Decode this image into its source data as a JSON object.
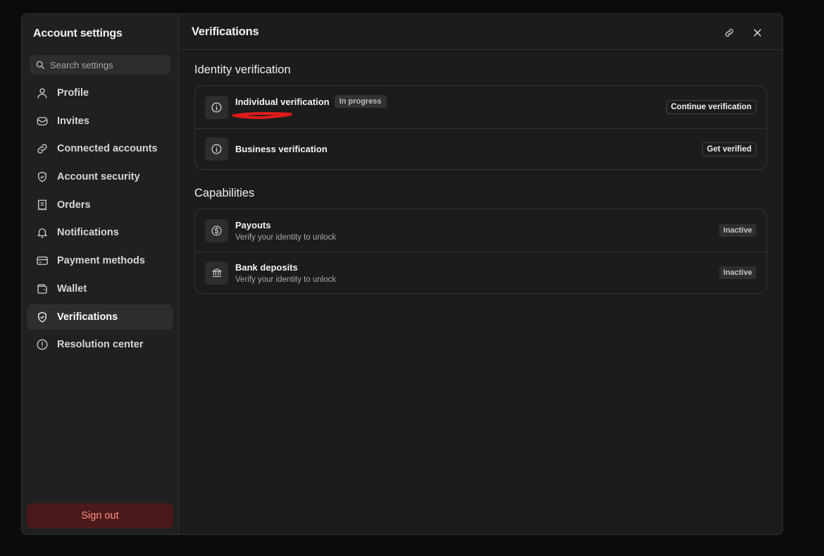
{
  "sidebar": {
    "title": "Account settings",
    "search_placeholder": "Search settings",
    "items": [
      {
        "label": "Profile",
        "icon": "user-icon"
      },
      {
        "label": "Invites",
        "icon": "inbox-icon"
      },
      {
        "label": "Connected accounts",
        "icon": "link-icon"
      },
      {
        "label": "Account security",
        "icon": "shield-icon"
      },
      {
        "label": "Orders",
        "icon": "receipt-icon"
      },
      {
        "label": "Notifications",
        "icon": "bell-icon"
      },
      {
        "label": "Payment methods",
        "icon": "credit-card-icon"
      },
      {
        "label": "Wallet",
        "icon": "wallet-icon"
      },
      {
        "label": "Verifications",
        "icon": "shield-check-icon",
        "active": true
      },
      {
        "label": "Resolution center",
        "icon": "alert-circle-icon"
      }
    ],
    "sign_out_label": "Sign out"
  },
  "header": {
    "title": "Verifications",
    "link_icon": "link-icon",
    "close_icon": "close-icon"
  },
  "identity": {
    "title": "Identity verification",
    "rows": [
      {
        "title": "Individual verification",
        "status": "In progress",
        "action": "Continue verification",
        "icon": "info-icon"
      },
      {
        "title": "Business verification",
        "action": "Get verified",
        "icon": "info-icon"
      }
    ]
  },
  "capabilities": {
    "title": "Capabilities",
    "rows": [
      {
        "title": "Payouts",
        "subtitle": "Verify your identity to unlock",
        "status": "Inactive",
        "icon": "dollar-circle-icon"
      },
      {
        "title": "Bank deposits",
        "subtitle": "Verify your identity to unlock",
        "status": "Inactive",
        "icon": "bank-icon"
      }
    ]
  },
  "colors": {
    "background": "#0b0b0b",
    "panel": "#1c1c1c",
    "sidebar": "#202020",
    "sign_out_bg": "#4a1a1a",
    "sign_out_text": "#ff8f82",
    "annotation": "#e01b1b"
  }
}
